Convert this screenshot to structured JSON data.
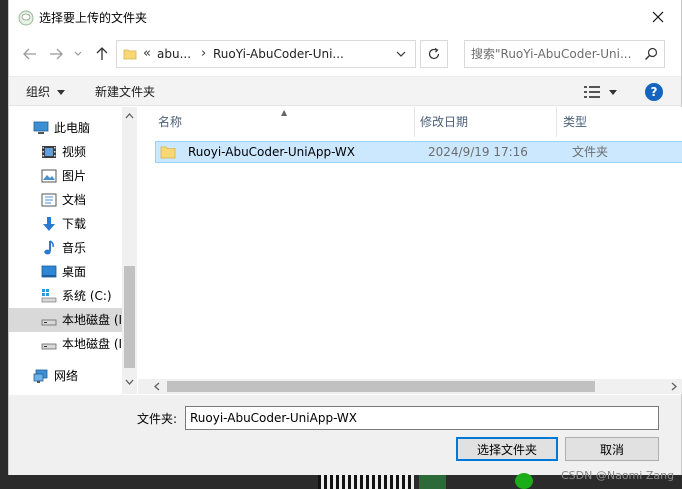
{
  "window": {
    "title": "选择要上传的文件夹",
    "close_icon": "close-icon"
  },
  "address": {
    "chevron": "«",
    "segments": [
      "abu...",
      "RuoYi-AbuCoder-Uni..."
    ],
    "separator": "›"
  },
  "search": {
    "placeholder": "搜索\"RuoYi-AbuCoder-Uni..."
  },
  "toolbar": {
    "organize_label": "组织",
    "new_folder_label": "新建文件夹",
    "help_label": "?"
  },
  "nav": {
    "items": [
      {
        "label": "此电脑",
        "icon": "computer-icon"
      },
      {
        "label": "视频",
        "icon": "video-icon"
      },
      {
        "label": "图片",
        "icon": "picture-icon"
      },
      {
        "label": "文档",
        "icon": "document-icon"
      },
      {
        "label": "下载",
        "icon": "download-icon"
      },
      {
        "label": "音乐",
        "icon": "music-icon"
      },
      {
        "label": "桌面",
        "icon": "desktop-icon"
      },
      {
        "label": "系统 (C:)",
        "icon": "system-drive-icon"
      },
      {
        "label": "本地磁盘 (I",
        "icon": "drive-icon",
        "selected": true
      },
      {
        "label": "本地磁盘 (I",
        "icon": "drive-icon"
      },
      {
        "label": "网络",
        "icon": "network-icon"
      }
    ]
  },
  "columns": {
    "name": "名称",
    "modified": "修改日期",
    "type": "类型"
  },
  "files": [
    {
      "name": "Ruoyi-AbuCoder-UniApp-WX",
      "modified": "2024/9/19 17:16",
      "type": "文件夹"
    }
  ],
  "footer": {
    "filename_label": "文件夹:",
    "filename_value": "Ruoyi-AbuCoder-UniApp-WX",
    "select_label": "选择文件夹",
    "cancel_label": "取消"
  },
  "background": {
    "watermark": "CSDN @Naomi Zang"
  },
  "colors": {
    "selection_bg": "#cce8ff",
    "selection_border": "#99d1ff",
    "accent": "#0078d7",
    "folder": "#f8d775"
  }
}
